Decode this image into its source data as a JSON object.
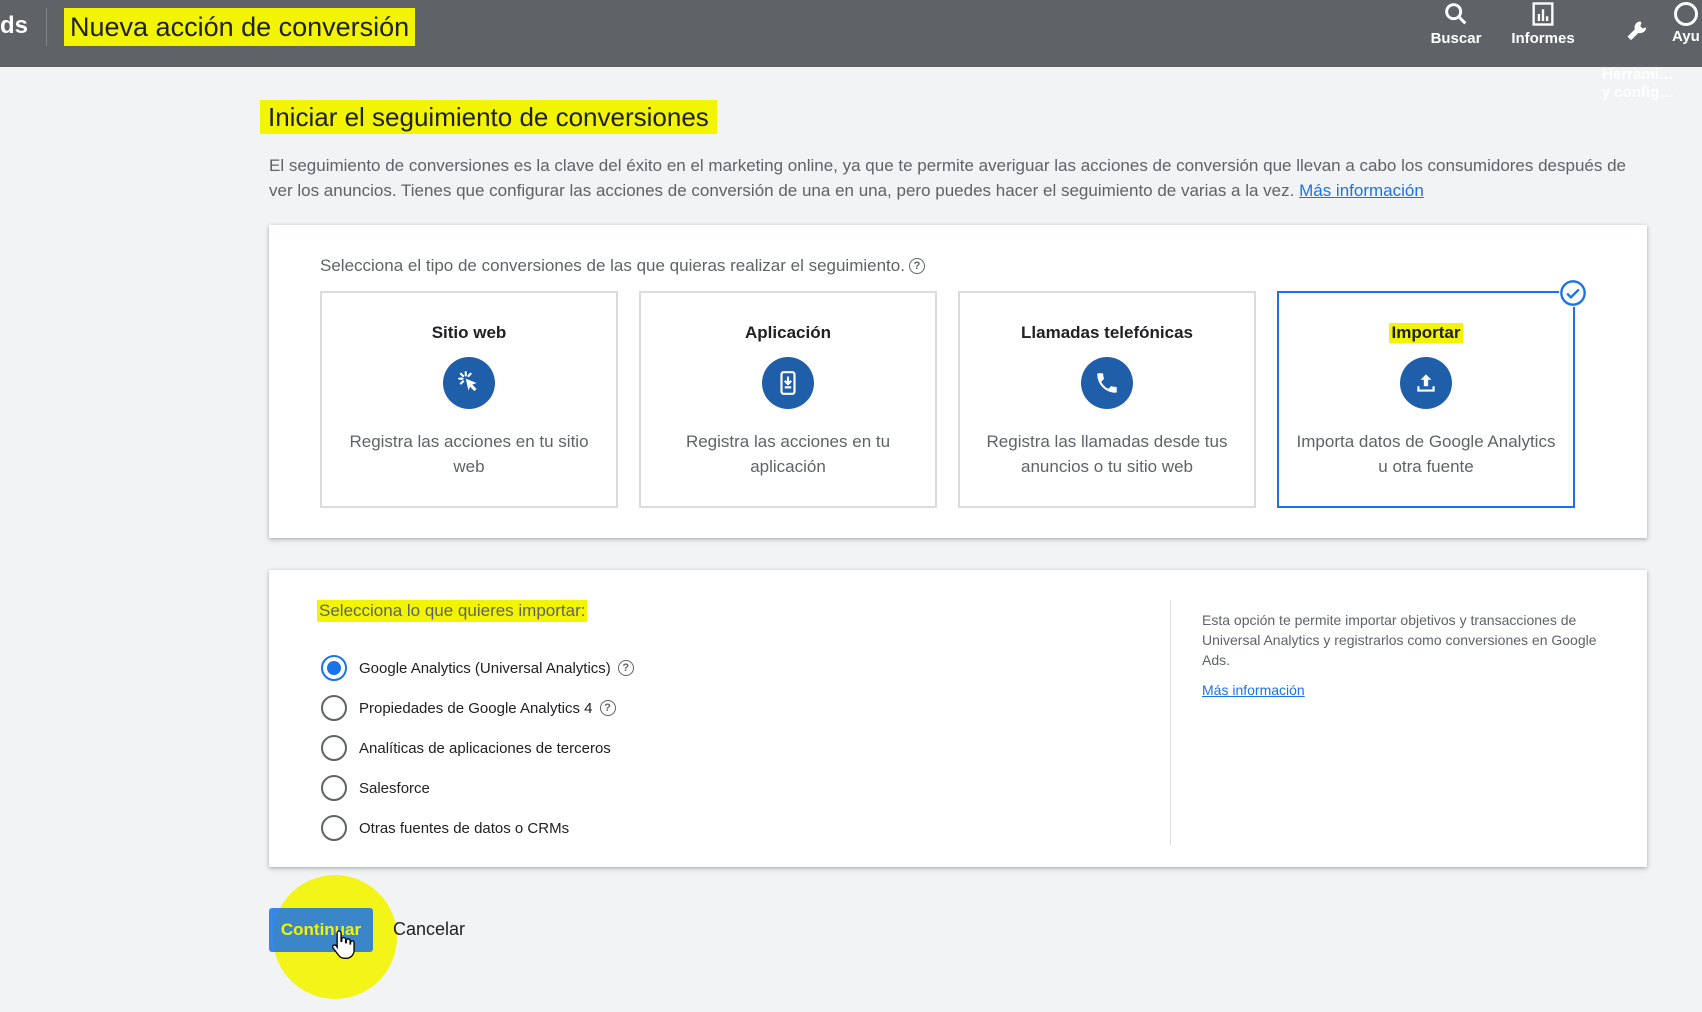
{
  "header": {
    "brand_fragment": "ds",
    "title": "Nueva acción de conversión",
    "tools": [
      {
        "label": "Buscar",
        "icon": "search-icon"
      },
      {
        "label": "Informes",
        "icon": "bar-chart-icon"
      },
      {
        "label": "Herrami…\ny config…",
        "icon": "wrench-icon"
      },
      {
        "label": "Ayu",
        "icon": "help-icon"
      }
    ]
  },
  "main": {
    "title": "Iniciar el seguimiento de conversiones",
    "intro": "El seguimiento de conversiones es la clave del éxito en el marketing online, ya que te permite averiguar las acciones de conversión que llevan a cabo los consumidores después de ver los anuncios. Tienes que configurar las acciones de conversión de una en una, pero puedes hacer el seguimiento de varias a la vez.",
    "intro_link": "Más información"
  },
  "conversion_types": {
    "prompt": "Selecciona el tipo de conversiones de las que quieras realizar el seguimiento.",
    "tiles": [
      {
        "title": "Sitio web",
        "description": "Registra las acciones en tu sitio web",
        "icon": "cursor-click-icon",
        "selected": false
      },
      {
        "title": "Aplicación",
        "description": "Registra las acciones en tu aplicación",
        "icon": "phone-download-icon",
        "selected": false
      },
      {
        "title": "Llamadas telefónicas",
        "description": "Registra las llamadas desde tus anuncios o tu sitio web",
        "icon": "phone-icon",
        "selected": false
      },
      {
        "title": "Importar",
        "description": "Importa datos de Google Analytics u otra fuente",
        "icon": "upload-icon",
        "selected": true
      }
    ]
  },
  "import_source": {
    "prompt": "Selecciona lo que quieres importar:",
    "options": [
      {
        "label": "Google Analytics (Universal Analytics)",
        "checked": true,
        "help": true
      },
      {
        "label": "Propiedades de Google Analytics 4",
        "checked": false,
        "help": true
      },
      {
        "label": "Analíticas de aplicaciones de terceros",
        "checked": false,
        "help": false
      },
      {
        "label": "Salesforce",
        "checked": false,
        "help": false
      },
      {
        "label": "Otras fuentes de datos o CRMs",
        "checked": false,
        "help": false
      }
    ],
    "info_text": "Esta opción te permite importar objetivos y transacciones de Universal Analytics y registrarlos como conversiones en Google Ads.",
    "info_link": "Más información"
  },
  "actions": {
    "continue_label": "Continuar",
    "cancel_label": "Cancelar"
  },
  "colors": {
    "topbar": "#5f6368",
    "accent": "#1a73e8",
    "icon_circle": "#1f5ea8",
    "highlight": "#f3f400"
  }
}
